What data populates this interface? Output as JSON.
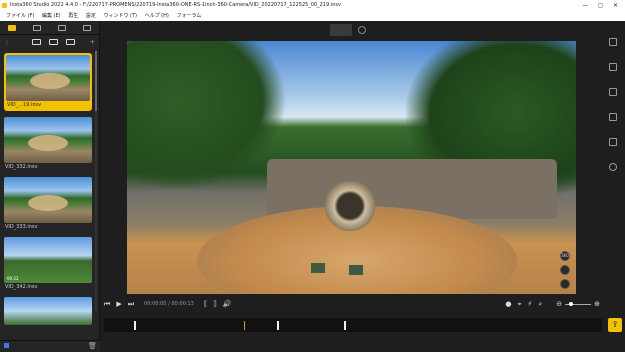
{
  "window": {
    "title": "Insta360 Studio 2022 4.4.0 - F:/220717-PROMENS/220719-Insta360-ONE-RS-1inch-360-Camera/VID_20220717_122525_00_219.insv",
    "minimize": "—",
    "maximize": "▢",
    "close": "✕"
  },
  "menu": {
    "items": [
      "ファイル (F)",
      "編集 (E)",
      "再生",
      "設定",
      "ウィンドウ (T)",
      "ヘルプ (H)",
      "フォーラム"
    ]
  },
  "sidebar": {
    "tabs": [
      "media-tab",
      "video-tab",
      "folder-tab",
      "file-tab"
    ],
    "tools": {
      "more": "⋮",
      "add": "+"
    },
    "items": [
      {
        "label": "VID_...19.insv",
        "duration": "",
        "selected": true
      },
      {
        "label": "VID_332.insv",
        "duration": "",
        "selected": false
      },
      {
        "label": "VID_333.insv",
        "duration": "",
        "selected": false
      },
      {
        "label": "VID_342.insv",
        "duration": "00:22",
        "selected": false
      },
      {
        "label": "",
        "duration": "",
        "selected": false
      }
    ]
  },
  "player": {
    "time_current": "00:00:00",
    "time_total": "00:00:13",
    "vr_button": "360",
    "icons": [
      "prev-icon",
      "play-icon",
      "next-icon",
      "trim-in-icon",
      "trim-out-icon",
      "volume-icon",
      "snapshot-icon",
      "target-icon",
      "flash-icon",
      "magnify-icon",
      "zoom-out-icon",
      "zoom-in-icon"
    ],
    "zoom_level": 0.15,
    "playhead_fraction": 0.35
  },
  "right_toolbar": {
    "icons": [
      "monitor-icon",
      "reframe-icon",
      "camera-icon",
      "list-icon",
      "export-panel-icon",
      "info-icon"
    ]
  },
  "export": {
    "icon": "export-icon"
  },
  "colors": {
    "accent": "#f2c200",
    "background": "#1e1e1e"
  }
}
